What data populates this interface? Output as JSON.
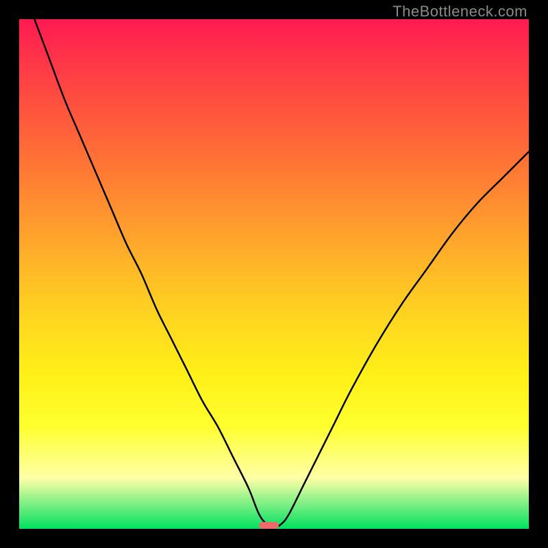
{
  "watermark": "TheBottleneck.com",
  "chart_data": {
    "type": "line",
    "title": "",
    "xlabel": "",
    "ylabel": "",
    "xlim": [
      0,
      100
    ],
    "ylim": [
      0,
      100
    ],
    "grid": false,
    "legend": false,
    "series": [
      {
        "name": "bottleneck-curve",
        "x": [
          3,
          6,
          9,
          12,
          15,
          18,
          21,
          24,
          27,
          30,
          33,
          36,
          39,
          42,
          45,
          47,
          48.5,
          50,
          51.5,
          53,
          56,
          59,
          62,
          65,
          70,
          75,
          80,
          85,
          90,
          95,
          100
        ],
        "y": [
          100,
          92,
          84,
          77,
          70,
          63,
          56,
          50,
          43,
          37,
          31,
          25,
          20,
          14,
          8,
          3,
          1,
          0.3,
          1,
          3,
          9,
          15,
          21,
          27,
          36,
          44,
          51,
          58,
          64,
          69,
          74
        ]
      }
    ],
    "optimal_marker": {
      "x_center": 49,
      "width_pct": 4
    },
    "background_gradient": {
      "top": "#ff1a52",
      "bottom": "#00e060"
    }
  }
}
